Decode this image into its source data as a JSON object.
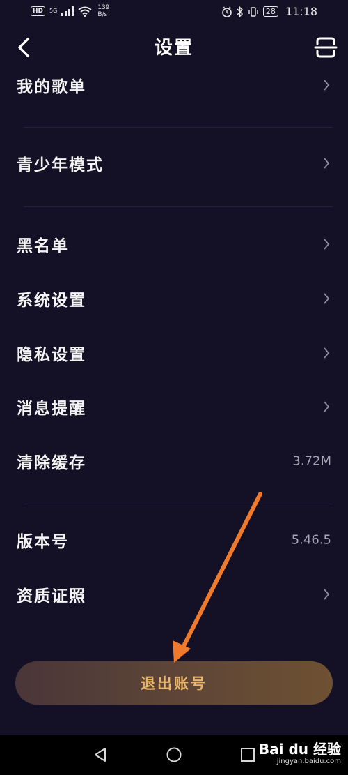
{
  "status_bar": {
    "hd": "HD",
    "network": "5G",
    "speed_value": "139",
    "speed_unit": "B/s",
    "battery": "28",
    "time": "11:18"
  },
  "header": {
    "title": "设置"
  },
  "settings": {
    "items": [
      {
        "label": "我的歌单",
        "value": ""
      },
      {
        "label": "青少年模式",
        "value": ""
      },
      {
        "label": "黑名单",
        "value": ""
      },
      {
        "label": "系统设置",
        "value": ""
      },
      {
        "label": "隐私设置",
        "value": ""
      },
      {
        "label": "消息提醒",
        "value": ""
      },
      {
        "label": "清除缓存",
        "value": "3.72M"
      },
      {
        "label": "版本号",
        "value": "5.46.5"
      },
      {
        "label": "资质证照",
        "value": ""
      }
    ]
  },
  "logout": {
    "label": "退出账号"
  },
  "watermark": {
    "logo": "Bai du 经验",
    "url": "jingyan.baidu.com"
  },
  "colors": {
    "background": "#141126",
    "accent_text": "#e8b56a",
    "arrow": "#f07a2c"
  }
}
